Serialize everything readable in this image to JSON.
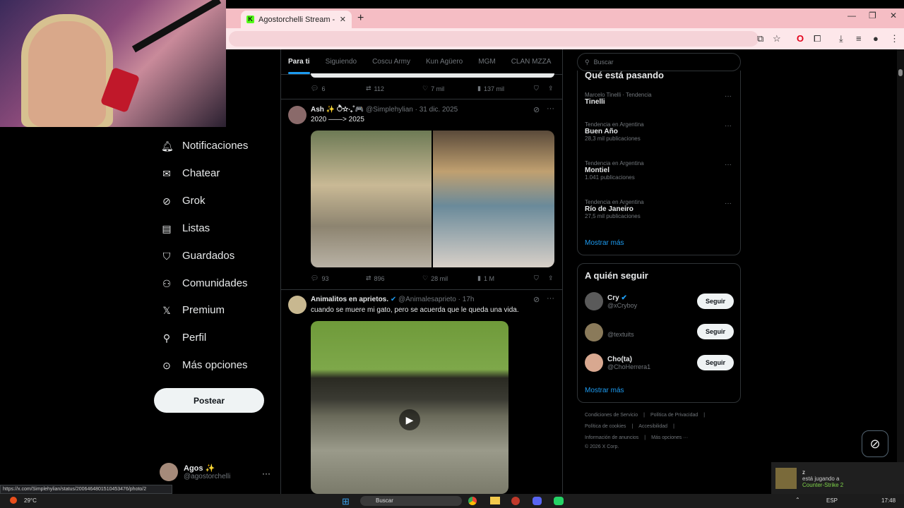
{
  "browser": {
    "tab_title": "Agostorchelli Stream - Watch L",
    "tab_favicon": "K",
    "new_tab": "+",
    "close_tab": "✕",
    "window_controls": [
      "—",
      "❐",
      "✕"
    ],
    "status_url": "https://x.com/Simplehylian/status/2006464801510453476/photo/2"
  },
  "sidebar": {
    "items": [
      {
        "label": "Notificaciones",
        "icon": "bell-icon"
      },
      {
        "label": "Chatear",
        "icon": "mail-icon"
      },
      {
        "label": "Grok",
        "icon": "grok-icon"
      },
      {
        "label": "Listas",
        "icon": "list-icon"
      },
      {
        "label": "Guardados",
        "icon": "bookmark-icon"
      },
      {
        "label": "Comunidades",
        "icon": "communities-icon"
      },
      {
        "label": "Premium",
        "icon": "x-logo-icon"
      },
      {
        "label": "Perfil",
        "icon": "person-icon"
      },
      {
        "label": "Más opciones",
        "icon": "more-circle-icon"
      }
    ],
    "post_button": "Postear",
    "account": {
      "name": "Agos ✨",
      "handle": "@agostorchelli",
      "more": "···"
    }
  },
  "timeline": {
    "tabs": [
      "Para ti",
      "Siguiendo",
      "Coscu Army",
      "Kun Agüero",
      "MGM",
      "CLAN MZZA"
    ],
    "active_tab": "Para ti",
    "top_actions": {
      "replies": "6",
      "reposts": "112",
      "likes": "7 mil",
      "views": "137 mil"
    },
    "posts": [
      {
        "name": "Ash ✨ ੈ✩‧₊˚🎮",
        "handle": "@Simplehylian",
        "date": "31 dic. 2025",
        "text": "2020 ——> 2025",
        "actions": {
          "replies": "93",
          "reposts": "896",
          "likes": "28 mil",
          "views": "1 M"
        }
      },
      {
        "name": "Animalitos en aprietos.",
        "handle": "@Animalesaprieto",
        "date": "17h",
        "text": "cuando se muere mi gato, pero se acuerda que le queda una vida."
      }
    ]
  },
  "right": {
    "search_placeholder": "Buscar",
    "trends_title": "Qué está pasando",
    "trends": [
      {
        "context": "Marcelo Tinelli · Tendencia",
        "title": "Tinelli",
        "count": ""
      },
      {
        "context": "Tendencia en Argentina",
        "title": "Buen Año",
        "count": "28,3 mil publicaciones"
      },
      {
        "context": "Tendencia en Argentina",
        "title": "Montiel",
        "count": "1.041 publicaciones"
      },
      {
        "context": "Tendencia en Argentina",
        "title": "Río de Janeiro",
        "count": "27,5 mil publicaciones"
      }
    ],
    "show_more": "Mostrar más",
    "who_title": "A quién seguir",
    "who": [
      {
        "name": "Cry",
        "handle": "@xCryboy",
        "verified": true
      },
      {
        "name": "",
        "handle": "@textuits",
        "verified": false
      },
      {
        "name": "Cho(ta)",
        "handle": "@ChoHerrera1",
        "verified": false
      }
    ],
    "follow_label": "Seguir",
    "footer": [
      [
        "Condiciones de Servicio",
        "|",
        "Política de Privacidad",
        "|"
      ],
      [
        "Política de cookies",
        "|",
        "Accesibilidad",
        "|"
      ],
      [
        "Información de anuncios",
        "|",
        "Más opciones ···"
      ],
      [
        "© 2026 X Corp."
      ]
    ]
  },
  "toast": {
    "user": "z",
    "line2": "está jugando a",
    "game": "Counter-Strike 2"
  },
  "taskbar": {
    "temp": "29°C",
    "search": "Buscar",
    "lang": "ESP",
    "time": "17:48"
  },
  "colors": {
    "accent": "#1d9bf0",
    "tabbar": "#f5bdc4",
    "bg": "#000000"
  }
}
